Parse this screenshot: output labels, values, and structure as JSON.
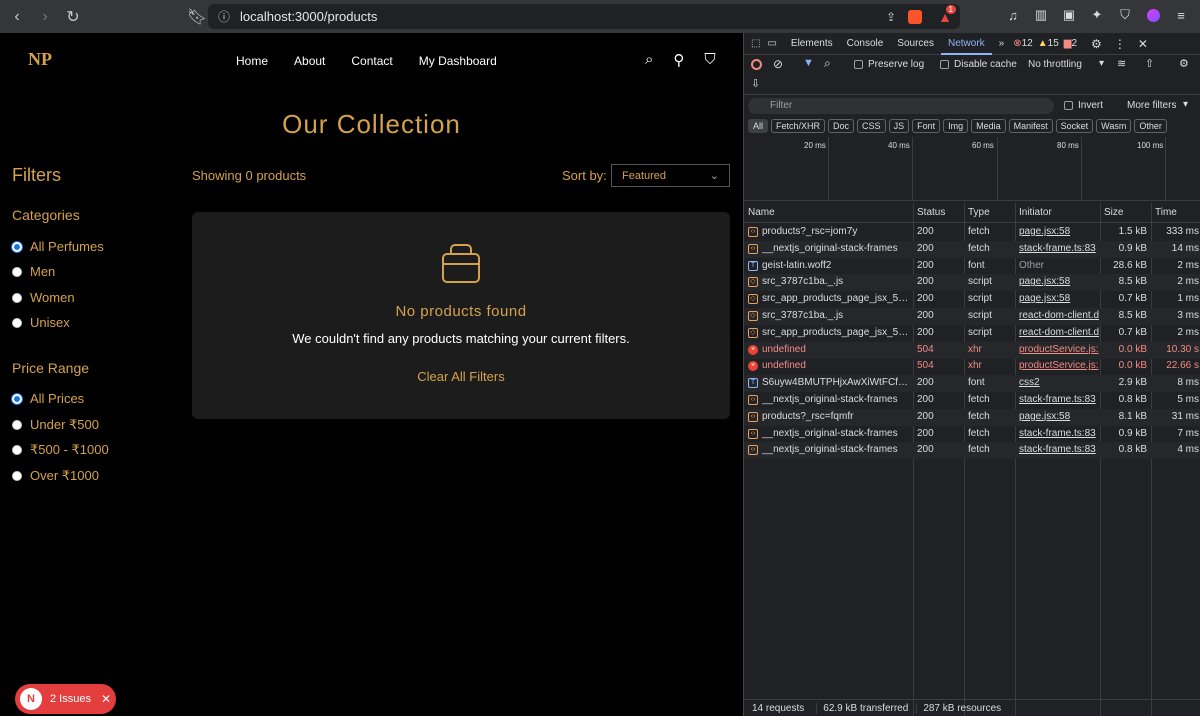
{
  "browser": {
    "url": "localhost:3000/products",
    "brave_badge": "1"
  },
  "site": {
    "logo_text": "NP",
    "nav": [
      "Home",
      "About",
      "Contact",
      "My Dashboard"
    ],
    "title": "Our Collection",
    "filters_heading": "Filters",
    "categories_heading": "Categories",
    "categories": [
      {
        "label": "All Perfumes",
        "selected": true
      },
      {
        "label": "Men",
        "selected": false
      },
      {
        "label": "Women",
        "selected": false
      },
      {
        "label": "Unisex",
        "selected": false
      }
    ],
    "price_heading": "Price Range",
    "prices": [
      {
        "label": "All Prices",
        "selected": true
      },
      {
        "label": "Under ₹500",
        "selected": false
      },
      {
        "label": "₹500 - ₹1000",
        "selected": false
      },
      {
        "label": "Over ₹1000",
        "selected": false
      }
    ],
    "showing": "Showing 0 products",
    "sort_label": "Sort by:",
    "sort_value": "Featured",
    "empty_title": "No products found",
    "empty_sub": "We couldn't find any products matching your current filters.",
    "clear_link": "Clear All Filters",
    "issues_letter": "N",
    "issues_label": "2 Issues"
  },
  "devtools": {
    "tabs": [
      "Elements",
      "Console",
      "Sources",
      "Network"
    ],
    "active_tab": "Network",
    "errors": "12",
    "warnings": "15",
    "issues": "2",
    "preserve_log": "Preserve log",
    "disable_cache": "Disable cache",
    "throttling": "No throttling",
    "filter_placeholder": "Filter",
    "invert": "Invert",
    "more_filters": "More filters",
    "chips": [
      "All",
      "Fetch/XHR",
      "Doc",
      "CSS",
      "JS",
      "Font",
      "Img",
      "Media",
      "Manifest",
      "Socket",
      "Wasm",
      "Other"
    ],
    "timeline_labels": [
      "20 ms",
      "40 ms",
      "60 ms",
      "80 ms",
      "100 ms"
    ],
    "columns": [
      "Name",
      "Status",
      "Type",
      "Initiator",
      "Size",
      "Time"
    ],
    "rows": [
      {
        "kind": "fetch",
        "name": "products?_rsc=jom7y",
        "status": "200",
        "type": "fetch",
        "initiator": "page.jsx:58",
        "size": "1.5 kB",
        "time": "333 ms"
      },
      {
        "kind": "fetch",
        "name": "__nextjs_original-stack-frames",
        "status": "200",
        "type": "fetch",
        "initiator": "stack-frame.ts:83",
        "size": "0.9 kB",
        "time": "14 ms"
      },
      {
        "kind": "font",
        "name": "geist-latin.woff2",
        "status": "200",
        "type": "font",
        "initiator": "Other",
        "size": "28.6 kB",
        "time": "2 ms"
      },
      {
        "kind": "script",
        "name": "src_3787c1ba._.js",
        "status": "200",
        "type": "script",
        "initiator": "page.jsx:58",
        "size": "8.5 kB",
        "time": "2 ms"
      },
      {
        "kind": "script",
        "name": "src_app_products_page_jsx_5…",
        "status": "200",
        "type": "script",
        "initiator": "page.jsx:58",
        "size": "0.7 kB",
        "time": "1 ms"
      },
      {
        "kind": "script",
        "name": "src_3787c1ba._.js",
        "status": "200",
        "type": "script",
        "initiator": "react-dom-client.d",
        "size": "8.5 kB",
        "time": "3 ms"
      },
      {
        "kind": "script",
        "name": "src_app_products_page_jsx_5…",
        "status": "200",
        "type": "script",
        "initiator": "react-dom-client.d",
        "size": "0.7 kB",
        "time": "2 ms"
      },
      {
        "kind": "err",
        "name": "undefined",
        "status": "504",
        "type": "xhr",
        "initiator": "productService.js:",
        "size": "0.0 kB",
        "time": "10.30 s"
      },
      {
        "kind": "err",
        "name": "undefined",
        "status": "504",
        "type": "xhr",
        "initiator": "productService.js:",
        "size": "0.0 kB",
        "time": "22.66 s"
      },
      {
        "kind": "font",
        "name": "S6uyw4BMUTPHjxAwXiWtFCf…",
        "status": "200",
        "type": "font",
        "initiator": "css2",
        "size": "2.9 kB",
        "time": "8 ms"
      },
      {
        "kind": "fetch",
        "name": "__nextjs_original-stack-frames",
        "status": "200",
        "type": "fetch",
        "initiator": "stack-frame.ts:83",
        "size": "0.8 kB",
        "time": "5 ms"
      },
      {
        "kind": "fetch",
        "name": "products?_rsc=fqmfr",
        "status": "200",
        "type": "fetch",
        "initiator": "page.jsx:58",
        "size": "8.1 kB",
        "time": "31 ms"
      },
      {
        "kind": "fetch",
        "name": "__nextjs_original-stack-frames",
        "status": "200",
        "type": "fetch",
        "initiator": "stack-frame.ts:83",
        "size": "0.9 kB",
        "time": "7 ms"
      },
      {
        "kind": "fetch",
        "name": "__nextjs_original-stack-frames",
        "status": "200",
        "type": "fetch",
        "initiator": "stack-frame.ts:83",
        "size": "0.8 kB",
        "time": "4 ms"
      }
    ],
    "summary": [
      "14 requests",
      "62.9 kB transferred",
      "287 kB resources"
    ]
  }
}
